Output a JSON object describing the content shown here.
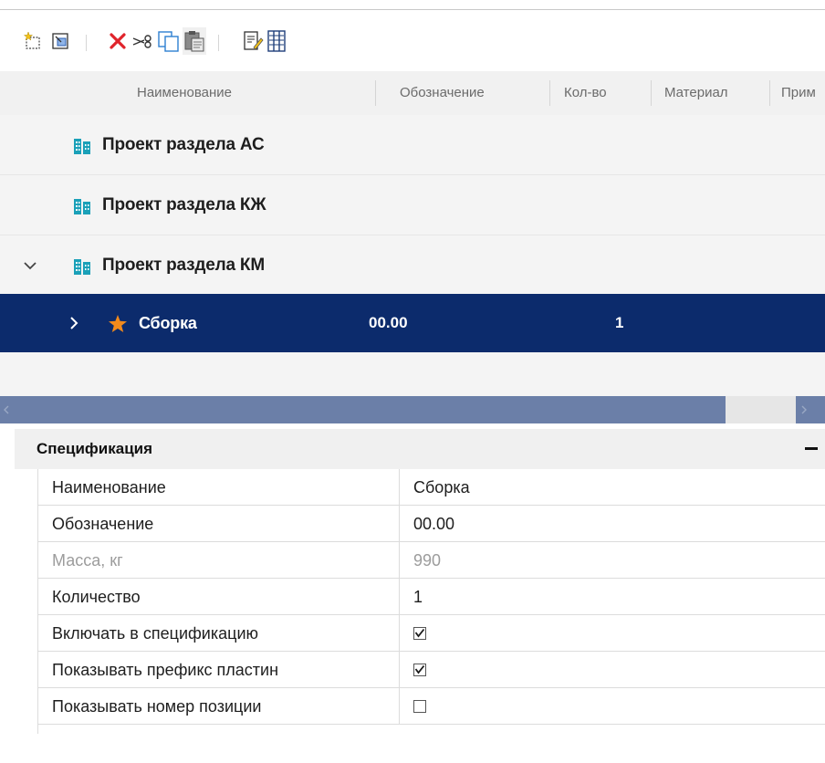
{
  "toolbar": {
    "buttons": [
      {
        "name": "new-element",
        "icon": "new-star-icon"
      },
      {
        "name": "insert",
        "icon": "insert-frame-icon"
      },
      {
        "name": "delete",
        "icon": "red-x-icon"
      },
      {
        "name": "cut",
        "icon": "scissors-icon"
      },
      {
        "name": "copy",
        "icon": "copy-icon"
      },
      {
        "name": "paste",
        "icon": "paste-icon"
      },
      {
        "name": "edit-properties",
        "icon": "edit-doc-icon"
      },
      {
        "name": "columns",
        "icon": "columns-icon"
      }
    ]
  },
  "columns": {
    "name": "Наименование",
    "designation": "Обозначение",
    "quantity": "Кол-во",
    "material": "Материал",
    "note": "Прим"
  },
  "tree": {
    "rows": [
      {
        "label": "Проект раздела АС",
        "icon": "building-icon"
      },
      {
        "label": "Проект раздела КЖ",
        "icon": "building-icon"
      },
      {
        "label": "Проект раздела КМ",
        "icon": "building-icon",
        "expanded": true
      },
      {
        "label": "Сборка",
        "icon": "star-icon",
        "designation": "00.00",
        "quantity": "1",
        "selected": true
      }
    ]
  },
  "spec": {
    "title": "Спецификация",
    "rows": [
      {
        "name": "Наименование",
        "value": "Сборка"
      },
      {
        "name": "Обозначение",
        "value": "00.00"
      },
      {
        "name": "Масса, кг",
        "value": "990",
        "disabled": true
      },
      {
        "name": "Количество",
        "value": "1"
      },
      {
        "name": "Включать в спецификацию",
        "checked": true
      },
      {
        "name": "Показывать префикс пластин",
        "checked": true
      },
      {
        "name": "Показывать номер позиции",
        "checked": false
      }
    ]
  },
  "colors": {
    "selection": "#0c2b6c",
    "scroll_thumb": "#6b7fa8",
    "building_icon": "#1aa0b8",
    "star_icon": "#f28a1c",
    "delete_icon": "#e0242b"
  }
}
